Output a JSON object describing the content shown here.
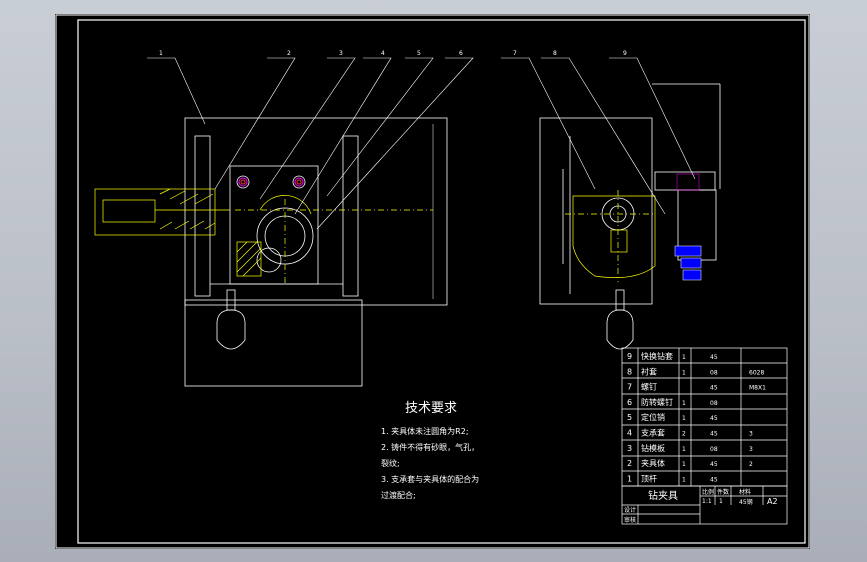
{
  "balloons": [
    "1",
    "2",
    "3",
    "4",
    "5",
    "6",
    "7",
    "8",
    "9"
  ],
  "tech_req": {
    "title": "技术要求",
    "lines": [
      "1. 夹具体未注圆角为R2;",
      "2. 铸件不得有砂眼，气孔，",
      "裂纹;",
      "3. 支承套与夹具体的配合为",
      "过渡配合;"
    ]
  },
  "bom": [
    {
      "no": "9",
      "name": "快换钻套",
      "qty": "1",
      "material": "45",
      "note": ""
    },
    {
      "no": "8",
      "name": "衬套",
      "qty": "1",
      "material": "08",
      "note": "6028"
    },
    {
      "no": "7",
      "name": "螺钉",
      "qty": "",
      "material": "45",
      "note": "M8X1"
    },
    {
      "no": "6",
      "name": "防转螺钉",
      "qty": "1",
      "material": "08",
      "note": ""
    },
    {
      "no": "5",
      "name": "定位销",
      "qty": "1",
      "material": "45",
      "note": ""
    },
    {
      "no": "4",
      "name": "支承套",
      "qty": "2",
      "material": "45",
      "note": "3"
    },
    {
      "no": "3",
      "name": "钻模板",
      "qty": "1",
      "material": "08",
      "note": "3"
    },
    {
      "no": "2",
      "name": "夹具体",
      "qty": "1",
      "material": "45",
      "note": "2"
    },
    {
      "no": "1",
      "name": "顶杆",
      "qty": "1",
      "material": "45",
      "note": ""
    }
  ],
  "title_block": {
    "name": "钻夹具",
    "h_scale": "比例",
    "h_qty": "件数",
    "h_material": "材料",
    "scale": "1:1",
    "qty": "1",
    "material": "45钢",
    "sheet": "A2",
    "designer_label": "设计",
    "checker_label": "审核"
  },
  "colors": {
    "line": "#ffffff",
    "yellow": "#ffff00",
    "magenta": "#ff00ff",
    "blue": "#0000ff",
    "red": "#ff3030"
  }
}
